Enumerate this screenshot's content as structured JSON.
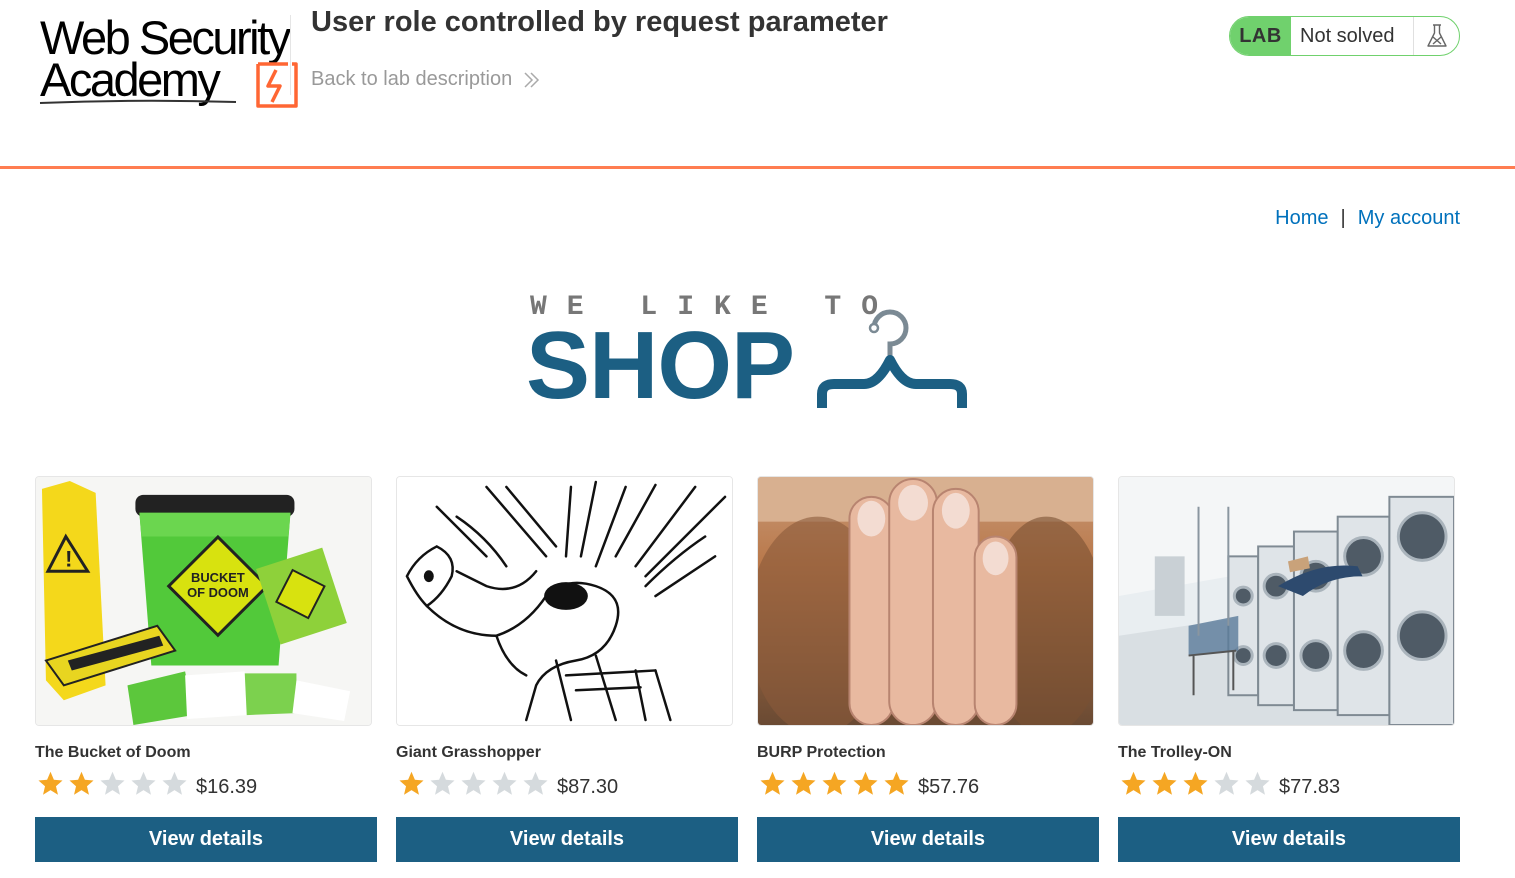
{
  "brand": {
    "line1": "Web Security",
    "line2": "Academy"
  },
  "lab": {
    "title": "User role controlled by request parameter",
    "back_link": "Back to lab description",
    "status_tag": "LAB",
    "status_text": "Not solved"
  },
  "nav": {
    "home": "Home",
    "separator": "|",
    "account": "My account"
  },
  "banner": {
    "tagline": "WE LIKE TO",
    "word": "SHOP"
  },
  "colors": {
    "accent": "#1c5f83",
    "link": "#0071bc",
    "lab_green": "#70d16d",
    "rule_orange": "#ff6633",
    "star_on": "#f5a623",
    "star_off": "#d5dadd"
  },
  "products": [
    {
      "name": "The Bucket of Doom",
      "rating": 2,
      "price": "$16.39",
      "button": "View details",
      "image": "bucket-of-doom-image"
    },
    {
      "name": "Giant Grasshopper",
      "rating": 1,
      "price": "$87.30",
      "button": "View details",
      "image": "grasshopper-sketch-image"
    },
    {
      "name": "BURP Protection",
      "rating": 5,
      "price": "$57.76",
      "button": "View details",
      "image": "beard-hand-image"
    },
    {
      "name": "The Trolley-ON",
      "rating": 3,
      "price": "$77.83",
      "button": "View details",
      "image": "laundromat-image"
    }
  ]
}
